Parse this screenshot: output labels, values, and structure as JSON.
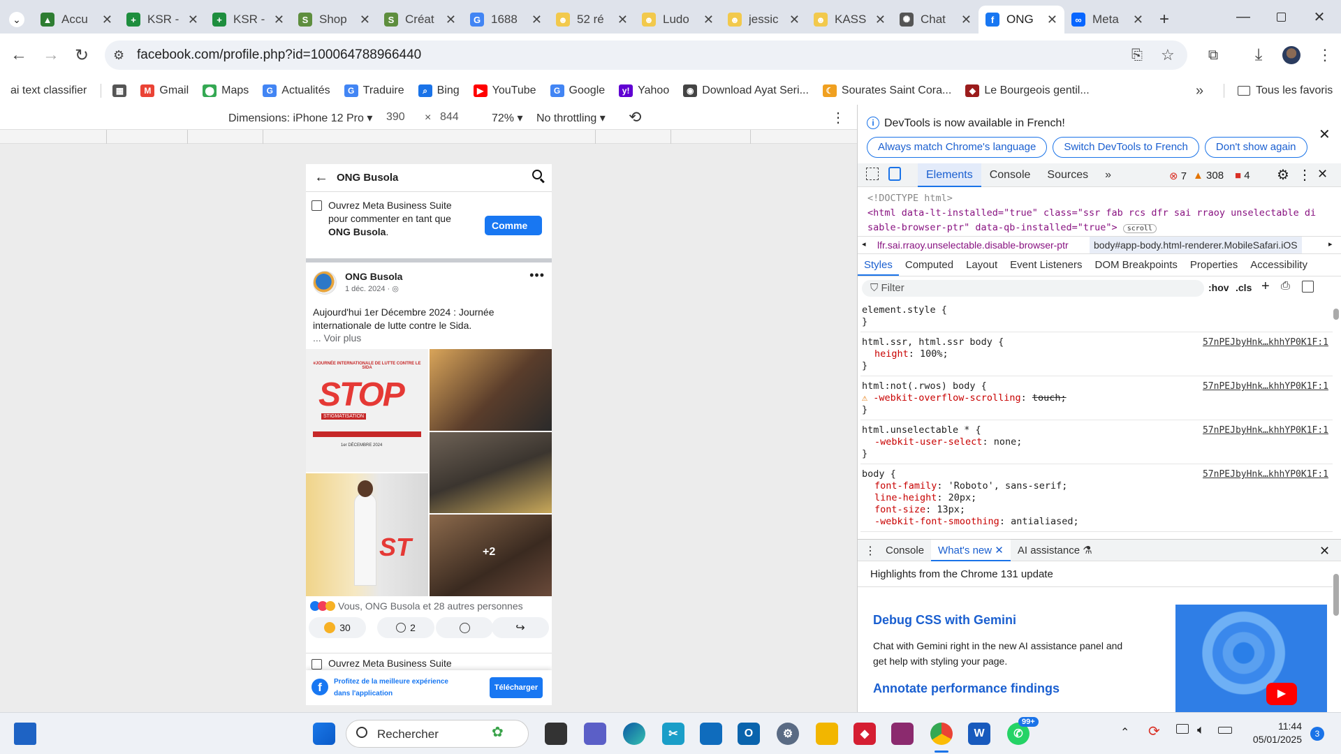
{
  "tabs": [
    {
      "title": "Accu",
      "color": "#2e7d32",
      "glyph": "▲"
    },
    {
      "title": "KSR -",
      "color": "#1e8e3e",
      "glyph": "+"
    },
    {
      "title": "KSR -",
      "color": "#1e8e3e",
      "glyph": "+"
    },
    {
      "title": "Shop",
      "color": "#5e8e3e",
      "glyph": "S"
    },
    {
      "title": "Créat",
      "color": "#5e8e3e",
      "glyph": "S"
    },
    {
      "title": "1688",
      "color": "#4285f4",
      "glyph": "G"
    },
    {
      "title": "52 ré",
      "color": "#f2c94c",
      "glyph": "☻"
    },
    {
      "title": "Ludo",
      "color": "#f2c94c",
      "glyph": "☻"
    },
    {
      "title": "jessic",
      "color": "#f2c94c",
      "glyph": "☻"
    },
    {
      "title": "KASS",
      "color": "#f2c94c",
      "glyph": "☻"
    },
    {
      "title": "Chat",
      "color": "#555555",
      "glyph": "✺"
    },
    {
      "title": "ONG",
      "color": "#1877f2",
      "glyph": "f",
      "active": true
    },
    {
      "title": "Meta",
      "color": "#0866ff",
      "glyph": "∞"
    }
  ],
  "address": {
    "url": "facebook.com/profile.php?id=100064788966440"
  },
  "bookmarks": [
    {
      "label": "ai text classifier",
      "color": "",
      "glyph": ""
    },
    {
      "label": "",
      "color": "#555",
      "glyph": "▦"
    },
    {
      "label": "Gmail",
      "color": "#ea4335",
      "glyph": "M"
    },
    {
      "label": "Maps",
      "color": "#34a853",
      "glyph": "⬤"
    },
    {
      "label": "Actualités",
      "color": "#4285f4",
      "glyph": "G"
    },
    {
      "label": "Traduire",
      "color": "#4285f4",
      "glyph": "G"
    },
    {
      "label": "Bing",
      "color": "#1a73e8",
      "glyph": "⌕"
    },
    {
      "label": "YouTube",
      "color": "#ff0000",
      "glyph": "▶"
    },
    {
      "label": "Google",
      "color": "#4285f4",
      "glyph": "G"
    },
    {
      "label": "Yahoo",
      "color": "#6001d2",
      "glyph": "y!"
    },
    {
      "label": "Download Ayat Seri...",
      "color": "#444",
      "glyph": "◉"
    },
    {
      "label": "Sourates Saint Cora...",
      "color": "#f0a020",
      "glyph": "☾"
    },
    {
      "label": "Le Bourgeois gentil...",
      "color": "#9b1c1c",
      "glyph": "◆"
    }
  ],
  "bookmarks_more": "»",
  "bookmarks_all": "Tous les favoris",
  "device_toolbar": {
    "dimensions": "Dimensions: iPhone 12 Pro",
    "width": "390",
    "times": "×",
    "height": "844",
    "zoom": "72%",
    "throttling": "No throttling"
  },
  "facebook": {
    "page_name": "ONG Busola",
    "meta_prompt_1": "Ouvrez Meta Business Suite pour commenter en tant que",
    "meta_prompt_bold": "ONG Busola",
    "meta_prompt_dot": ".",
    "comment_button": "Comme",
    "post_author": "ONG Busola",
    "post_date": "1 déc. 2024 ·",
    "post_text": "Aujourd'hui 1er Décembre 2024 : Journée internationale de lutte contre le Sida.",
    "see_more": "... Voir plus",
    "poster_title": "#JOURNÉE INTERNATIONALE DE LUTTE CONTRE LE SIDA",
    "poster_stop": "STOP",
    "poster_sub": "STIGMATISATION",
    "poster_date": "1er DÉCEMBRE 2024",
    "more_photos": "+2",
    "reactions": "Vous, ONG Busola et 28 autres personnes",
    "reaction_count": "30",
    "comment_count": "2",
    "meta_prompt_2": "Ouvrez Meta Business Suite",
    "app_banner": "Profitez de la meilleure expérience dans l'application",
    "download_button": "Télécharger"
  },
  "devtools": {
    "notice": "DevTools is now available in French!",
    "btn_match": "Always match Chrome's language",
    "btn_switch": "Switch DevTools to French",
    "btn_dont": "Don't show again",
    "tabs": [
      "Elements",
      "Console",
      "Sources",
      "»"
    ],
    "errors": "7",
    "warnings": "308",
    "issues": "4",
    "html_line1": "<!DOCTYPE html>",
    "html_line2a": "<html data-lt-installed=\"true\" class=\"ssr fab rcs dfr sai rraoy unselectable di",
    "html_line2b": "sable-browser-ptr\" data-qb-installed=\"true\">",
    "scroll_badge": "scroll",
    "breadcrumb_left": "lfr.sai.rraoy.unselectable.disable-browser-ptr",
    "breadcrumb_right": "body#app-body.html-renderer.MobileSafari.iOS",
    "subtabs": [
      "Styles",
      "Computed",
      "Layout",
      "Event Listeners",
      "DOM Breakpoints",
      "Properties",
      "Accessibility"
    ],
    "filter_placeholder": "Filter",
    "hov": ":hov",
    "cls": ".cls",
    "rules": [
      {
        "selector": "element.style {",
        "lines": [],
        "close": "}",
        "source": ""
      },
      {
        "selector": "html.ssr, html.ssr body {",
        "lines": [
          {
            "p": "height",
            "v": "100%;"
          }
        ],
        "close": "}",
        "source": "57nPEJbyHnk…khhYP0K1F:1"
      },
      {
        "selector": "html:not(.rwos) body {",
        "lines": [
          {
            "p": "-webkit-overflow-scrolling",
            "v": "touch;",
            "warn": true
          }
        ],
        "close": "}",
        "source": "57nPEJbyHnk…khhYP0K1F:1"
      },
      {
        "selector": "html.unselectable * {",
        "lines": [
          {
            "p": "-webkit-user-select",
            "v": "none;"
          }
        ],
        "close": "}",
        "source": "57nPEJbyHnk…khhYP0K1F:1"
      },
      {
        "selector": "body {",
        "lines": [
          {
            "p": "font-family",
            "v": "'Roboto', sans-serif;"
          },
          {
            "p": "line-height",
            "v": "20px;"
          },
          {
            "p": "font-size",
            "v": "13px;"
          },
          {
            "p": "-webkit-font-smoothing",
            "v": "antialiased;"
          }
        ],
        "close": "",
        "source": "57nPEJbyHnk…khhYP0K1F:1"
      }
    ],
    "drawer_tabs": [
      "Console",
      "What's new",
      "AI assistance"
    ],
    "whats_new_header": "Highlights from the Chrome 131 update",
    "article1_title": "Debug CSS with Gemini",
    "article1_text": "Chat with Gemini right in the new AI assistance panel and get help with styling your page.",
    "article2_title": "Annotate performance findings"
  },
  "taskbar": {
    "search_placeholder": "Rechercher",
    "time": "11:44",
    "date": "05/01/2025",
    "notification_count": "3",
    "whatsapp_badge": "99+"
  },
  "colors": {
    "facebook_blue": "#1877f2",
    "devtools_blue": "#1a73e8",
    "accent_red": "#d93025"
  }
}
